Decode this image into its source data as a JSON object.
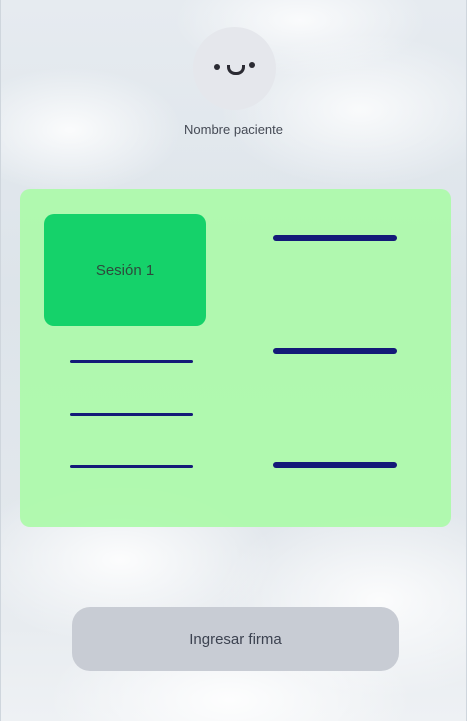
{
  "patient": {
    "avatar_icon": "smiley-face-icon",
    "name": "Nombre paciente"
  },
  "session_card": {
    "background_color": "#b0f8b0",
    "session_tile": {
      "label": "Sesión 1",
      "color": "#15d26a"
    },
    "line_color": "#141a78"
  },
  "sign_button": {
    "label": "Ingresar firma",
    "color": "#c8ccd4"
  }
}
